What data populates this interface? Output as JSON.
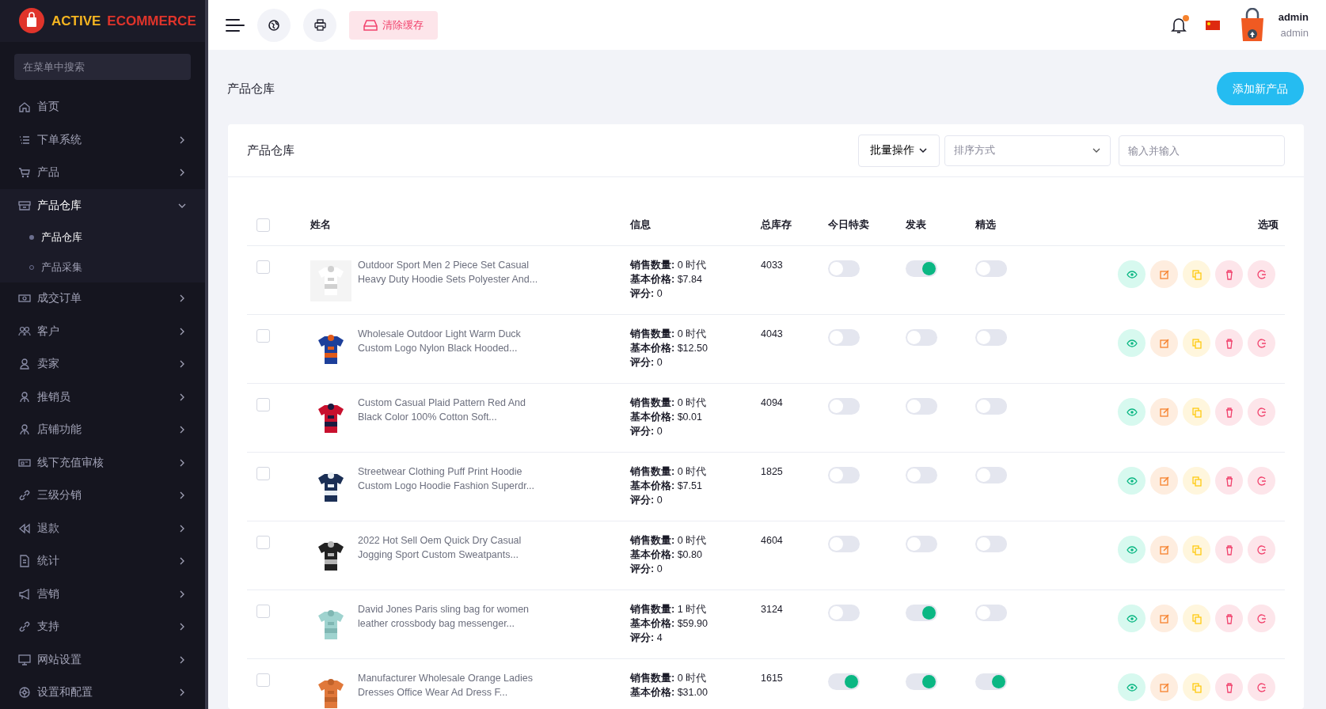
{
  "brand": {
    "first": "ACTIVE",
    "second": "ECOMMERCE"
  },
  "sidebar": {
    "search": {
      "placeholder": "在菜单中搜索"
    },
    "items": [
      {
        "label": "首页",
        "kind": "link"
      },
      {
        "label": "下单系统",
        "kind": "group",
        "expanded": false
      },
      {
        "label": "产品",
        "kind": "group",
        "expanded": false
      },
      {
        "label": "产品仓库",
        "kind": "group",
        "expanded": true,
        "children": [
          {
            "label": "产品仓库",
            "selected": true
          },
          {
            "label": "产品采集",
            "selected": false
          }
        ]
      },
      {
        "label": "成交订单",
        "kind": "group",
        "expanded": false
      },
      {
        "label": "客户",
        "kind": "group",
        "expanded": false
      },
      {
        "label": "卖家",
        "kind": "group",
        "expanded": false
      },
      {
        "label": "推销员",
        "kind": "group",
        "expanded": false
      },
      {
        "label": "店铺功能",
        "kind": "group",
        "expanded": false
      },
      {
        "label": "线下充值审核",
        "kind": "group",
        "expanded": false
      },
      {
        "label": "三级分销",
        "kind": "group",
        "expanded": false
      },
      {
        "label": "退款",
        "kind": "group",
        "expanded": false
      },
      {
        "label": "统计",
        "kind": "group",
        "expanded": false
      },
      {
        "label": "营销",
        "kind": "group",
        "expanded": false
      },
      {
        "label": "支持",
        "kind": "group",
        "expanded": false
      },
      {
        "label": "网站设置",
        "kind": "group",
        "expanded": false
      },
      {
        "label": "设置和配置",
        "kind": "group",
        "expanded": false
      }
    ]
  },
  "topbar": {
    "clear_cache": "清除缓存",
    "notifications_unread": true,
    "user": {
      "name": "admin",
      "role": "admin"
    }
  },
  "page": {
    "title": "产品仓库",
    "add_button": "添加新产品"
  },
  "card": {
    "title": "产品仓库",
    "bulk_action": "批量操作",
    "sort": {
      "placeholder": "排序方式"
    },
    "search": {
      "placeholder": "输入并输入"
    },
    "columns": [
      "姓名",
      "信息",
      "总库存",
      "今日特卖",
      "发表",
      "精选",
      "选项"
    ],
    "select_all": {
      "checked": false
    },
    "rows": [
      {
        "checked": false,
        "name": "Outdoor Sport Men 2 Piece Set Casual Heavy Duty Hoodie Sets Polyester And...",
        "info": [
          "**销售数量:** 0 时代",
          "**基本价格:** $7.84",
          "**评分:** 0"
        ],
        "stock": "4033",
        "todays_deal": false,
        "published": true,
        "featured": false
      },
      {
        "checked": false,
        "name": "Wholesale Outdoor Light Warm Duck Custom Logo Nylon Black Hooded...",
        "info": [
          "**销售数量:** 0 时代",
          "**基本价格:** $12.50",
          "**评分:** 0"
        ],
        "stock": "4043",
        "todays_deal": false,
        "published": false,
        "featured": false
      },
      {
        "checked": false,
        "name": "Custom Casual Plaid Pattern Red And Black Color 100% Cotton Soft...",
        "info": [
          "**销售数量:** 0 时代",
          "**基本价格:** $0.01",
          "**评分:** 0"
        ],
        "stock": "4094",
        "todays_deal": false,
        "published": false,
        "featured": false
      },
      {
        "checked": false,
        "name": "Streetwear Clothing Puff Print Hoodie Custom Logo Hoodie Fashion Superdr...",
        "info": [
          "**销售数量:** 0 时代",
          "**基本价格:** $7.51",
          "**评分:** 0"
        ],
        "stock": "1825",
        "todays_deal": false,
        "published": false,
        "featured": false
      },
      {
        "checked": false,
        "name": "2022 Hot Sell Oem Quick Dry Casual Jogging Sport Custom Sweatpants...",
        "info": [
          "**销售数量:** 0 时代",
          "**基本价格:** $0.80",
          "**评分:** 0"
        ],
        "stock": "4604",
        "todays_deal": false,
        "published": false,
        "featured": false
      },
      {
        "checked": false,
        "name": "David Jones Paris sling bag for women leather crossbody bag messenger...",
        "info": [
          "**销售数量:** 1 时代",
          "**基本价格:** $59.90",
          "**评分:** 4"
        ],
        "stock": "3124",
        "todays_deal": false,
        "published": true,
        "featured": false
      },
      {
        "checked": false,
        "name": "Manufacturer Wholesale Orange Ladies Dresses Office Wear Ad Dress F...",
        "info": [
          "**销售数量:** 0 时代",
          "**基本价格:** $31.00"
        ],
        "stock": "1615",
        "todays_deal": true,
        "published": true,
        "featured": true
      }
    ]
  }
}
